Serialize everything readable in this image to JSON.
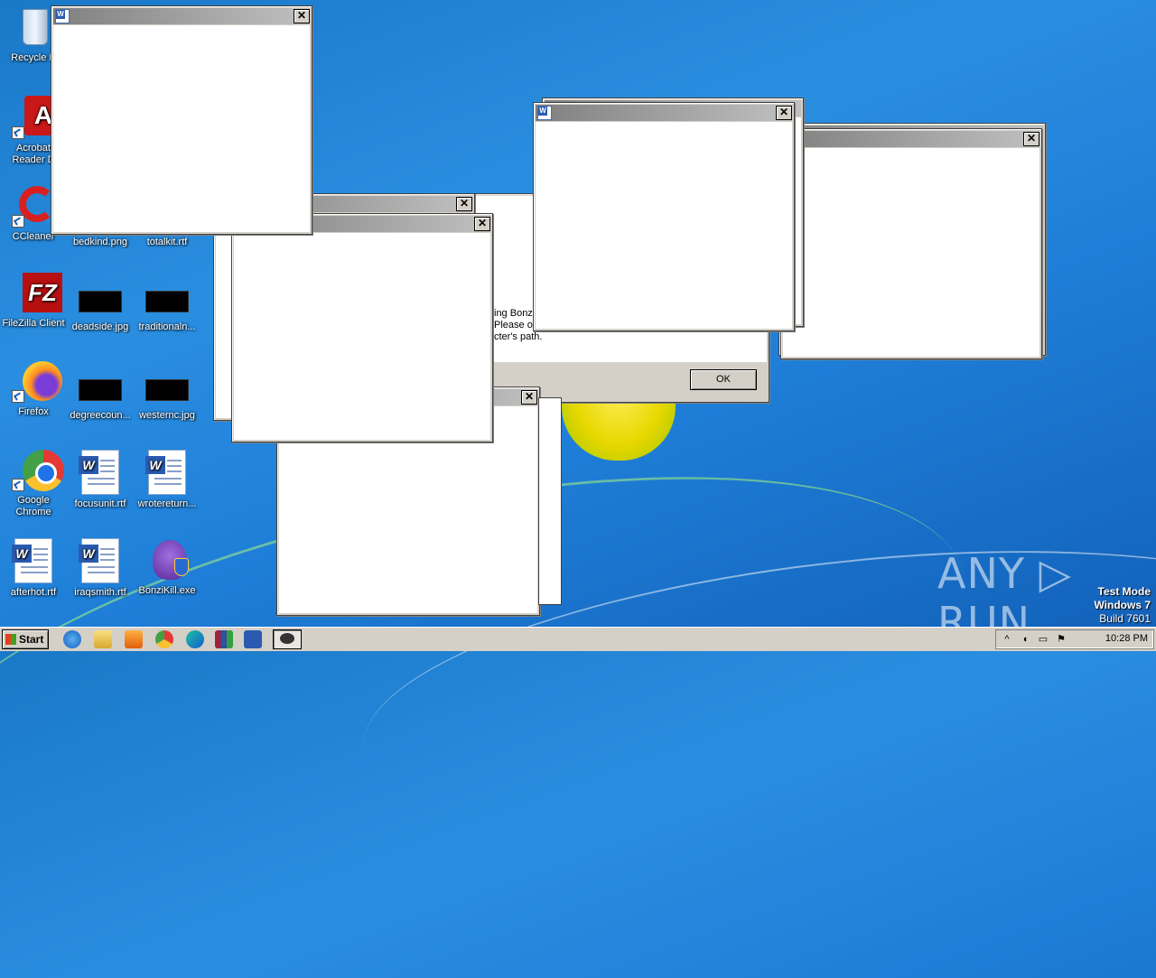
{
  "desktop": {
    "icons": [
      {
        "label": "Recycle B"
      },
      {
        "label": "Acrobat Reader D"
      },
      {
        "label": "CCleaner"
      },
      {
        "label": "bedkind.png"
      },
      {
        "label": "totalkit.rtf"
      },
      {
        "label": "FileZilla Client"
      },
      {
        "label": "deadside.jpg"
      },
      {
        "label": "traditionaln..."
      },
      {
        "label": "Firefox"
      },
      {
        "label": "degreecoun..."
      },
      {
        "label": "westernc.jpg"
      },
      {
        "label": "Google Chrome"
      },
      {
        "label": "focusunit.rtf"
      },
      {
        "label": "wrotereturn..."
      },
      {
        "label": "afterhot.rtf"
      },
      {
        "label": "iraqsmith.rtf"
      },
      {
        "label": "BonziKill.exe"
      }
    ]
  },
  "dialog": {
    "line1": "ing Bonzi",
    "line2": "Please op",
    "line3": "cter's path.",
    "ok_label": "OK"
  },
  "windows": {
    "close_glyph": "✕"
  },
  "taskbar": {
    "start_label": "Start",
    "clock": "10:28 PM"
  },
  "watermark": {
    "text": "ANY ▷ RUN"
  },
  "testmode": {
    "line1": "Test Mode",
    "line2": "Windows 7",
    "line3": "Build 7601"
  }
}
